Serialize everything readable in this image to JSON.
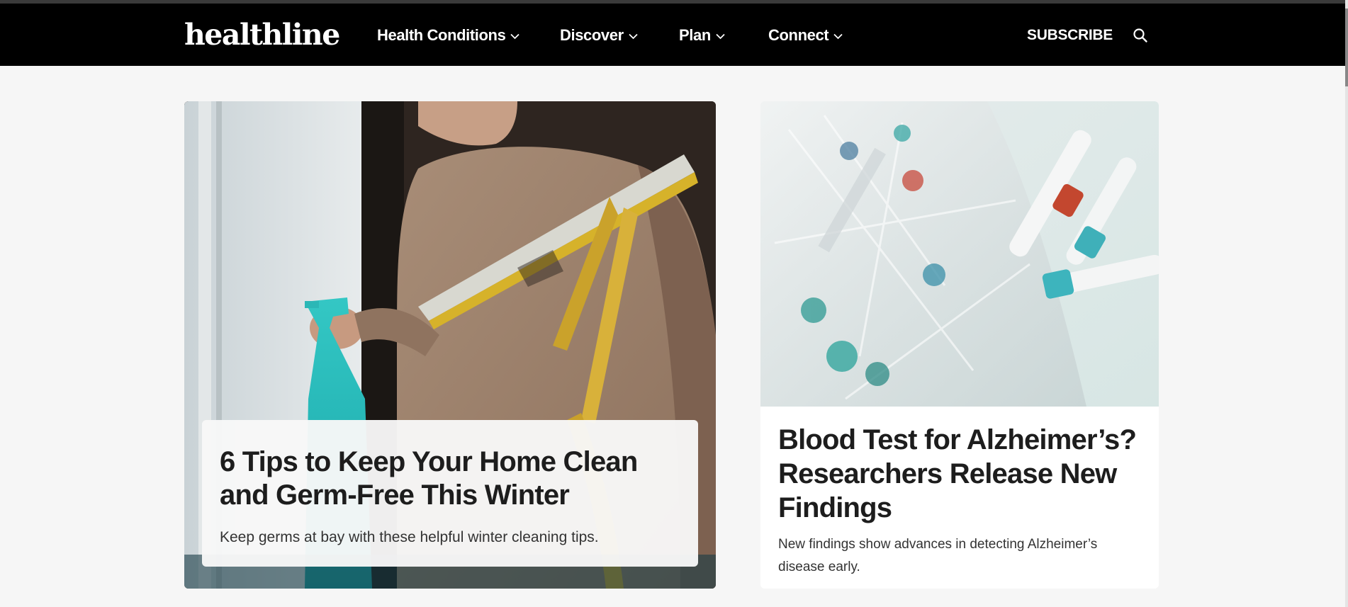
{
  "header": {
    "logo": "healthline",
    "nav": [
      {
        "label": "Health Conditions"
      },
      {
        "label": "Discover"
      },
      {
        "label": "Plan"
      },
      {
        "label": "Connect"
      }
    ],
    "subscribe_label": "SUBSCRIBE",
    "search_icon": "search-icon"
  },
  "articles": [
    {
      "title": "6 Tips to Keep Your Home Clean and Germ-Free This Winter",
      "dek": "Keep germs at bay with these helpful winter cleaning tips.",
      "image": "person-cleaning-window-with-squeegee-and-spray-bottle"
    },
    {
      "title": "Blood Test for Alzheimer’s? Researchers Release New Findings",
      "dek": "New findings show advances in detecting Alzheimer’s disease early.",
      "image": "blood-test-tubes-in-plastic-bag"
    }
  ],
  "colors": {
    "navbar": "#000000",
    "page_bg": "#f6f6f6",
    "headline": "#1d1d1d"
  }
}
